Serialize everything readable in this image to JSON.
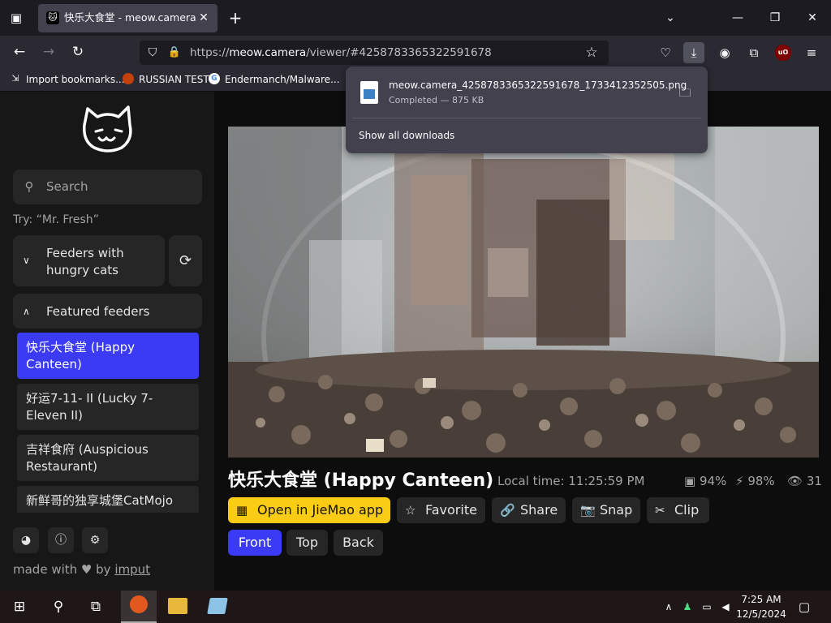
{
  "browser": {
    "tab_title": "快乐大食堂 - meow.camera",
    "tab_close": "✕",
    "new_tab": "+",
    "url_scheme": "https://",
    "url_host": "meow.camera",
    "url_path": "/viewer/#4258783365322591678",
    "ublock_label": "uO"
  },
  "bookmarks": [
    {
      "label": "Import bookmarks..."
    },
    {
      "label": "RUSSIAN TEST"
    },
    {
      "label": "Endermanch/Malware..."
    }
  ],
  "downloads_panel": {
    "file_name": "meow.camera_4258783365322591678_1733412352505.png",
    "status": "Completed — 875 KB",
    "show_all": "Show all downloads"
  },
  "sidebar": {
    "search_placeholder": "Search",
    "try_hint": "Try: “Mr. Fresh”",
    "hungry_label": "Feeders with hungry cats",
    "featured_label": "Featured feeders",
    "feeders": [
      {
        "label": "快乐大食堂 (Happy Canteen)",
        "active": true
      },
      {
        "label": "好运7-11- II (Lucky 7-Eleven II)",
        "active": false
      },
      {
        "label": "吉祥食府 (Auspicious Restaurant)",
        "active": false
      },
      {
        "label": "新鲜哥的独享城堡CatMojo",
        "active": false
      }
    ],
    "made_with_prefix": "made with ♥ by",
    "made_with_link": "imput"
  },
  "viewer": {
    "title": "快乐大食堂 (Happy Canteen)",
    "local_time": "Local time: 11:25:59 PM",
    "stat_food": "94%",
    "stat_battery": "98%",
    "stat_viewers": "31",
    "actions": {
      "open_app": "Open in JieMao app",
      "favorite": "Favorite",
      "share": "Share",
      "snap": "Snap",
      "clip": "Clip"
    },
    "cameras": {
      "front": "Front",
      "top": "Top",
      "back": "Back"
    }
  },
  "taskbar": {
    "time": "7:25 AM",
    "date": "12/5/2024"
  }
}
